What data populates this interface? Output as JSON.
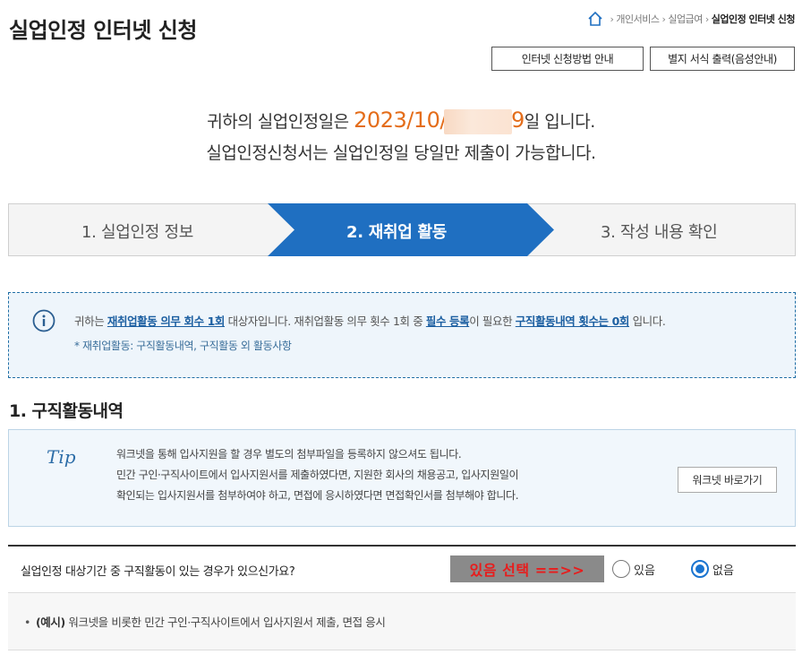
{
  "header": {
    "title": "실업인정 인터넷 신청",
    "breadcrumb": [
      {
        "label": "개인서비스"
      },
      {
        "label": "실업급여"
      },
      {
        "label": "실업인정 인터넷 신청"
      }
    ],
    "buttons": {
      "guide": "인터넷 신청방법 안내",
      "print": "별지 서식 출력(음성안내)"
    }
  },
  "notice": {
    "line1_prefix": "귀하의 실업인정일은 ",
    "date_visible": "2023/10/",
    "date_tail": "9",
    "line1_suffix": "일 입니다.",
    "line2": "실업인정신청서는 실업인정일 당일만 제출이 가능합니다."
  },
  "steps": [
    {
      "label": "1. 실업인정 정보",
      "active": false
    },
    {
      "label": "2. 재취업 활동",
      "active": true
    },
    {
      "label": "3. 작성 내용 확인",
      "active": false
    }
  ],
  "info": {
    "p1": "귀하는 ",
    "hl1": "재취업활동 의무 회수 1회",
    "p2": " 대상자입니다. 재취업활동 의무 횟수 1회 중 ",
    "hl2": "필수 등록",
    "p3": "이 필요한 ",
    "hl3": "구직활동내역 횟수는 0회",
    "p4": " 입니다.",
    "note": "* 재취업활동: 구직활동내역, 구직활동 외 활동사항"
  },
  "section": {
    "title": "1. 구직활동내역"
  },
  "tip": {
    "mark": "Tip",
    "lines": [
      "워크넷을 통해 입사지원을 할 경우 별도의 첨부파일을 등록하지 않으셔도 됩니다.",
      "민간 구인·구직사이트에서 입사지원서를 제출하였다면, 지원한 회사의 채용공고, 입사지원일이",
      "확인되는 입사지원서를 첨부하여야 하고, 면접에 응시하였다면 면접확인서를 첨부해야 합니다."
    ],
    "button": "워크넷 바로가기"
  },
  "question": {
    "text": "실업인정 대상기간 중 구직활동이 있는 경우가 있으신가요?",
    "annotation": "있음 선택 ==>>",
    "options": [
      {
        "label": "있음",
        "checked": false
      },
      {
        "label": "없음",
        "checked": true
      }
    ]
  },
  "example": {
    "label": "(예시)",
    "text": " 워크넷을 비롯한 민간 구인·구직사이트에서 입사지원서 제출, 면접 응시"
  },
  "colors": {
    "accent_blue": "#1f6fc1",
    "date_orange": "#e46d1a",
    "annotation_red": "#e81c1c"
  }
}
